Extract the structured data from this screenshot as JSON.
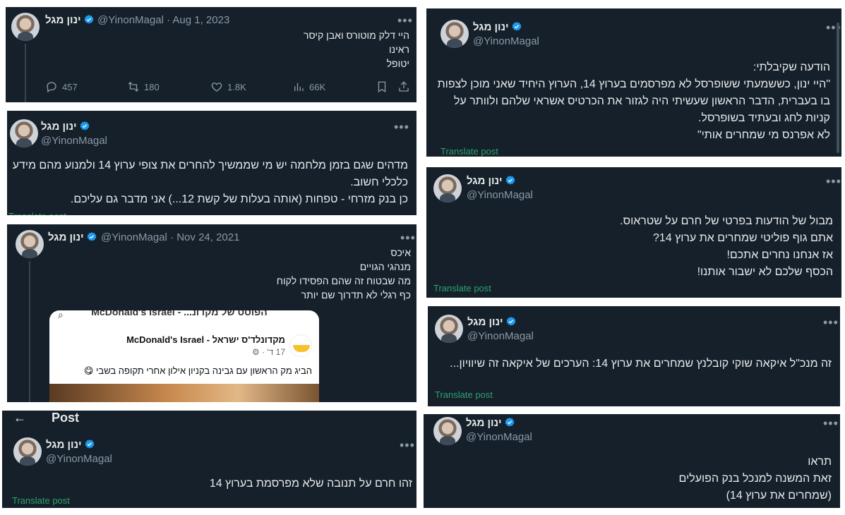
{
  "author": {
    "name": "ינון מגל",
    "handle": "@YinonMagal"
  },
  "more_icon": "•••",
  "translate_label": "Translate post",
  "tweets": {
    "t1": {
      "date": "· Aug 1, 2023",
      "text": "היי דלק מוטורס ואבן קיסר\nראינו\nיטופל",
      "stats": {
        "replies": "457",
        "reposts": "180",
        "likes": "1.8K",
        "views": "66K"
      }
    },
    "t2": {
      "text": "הודעה שקיבלתי:\n\"היי ינון, כששמעתי ששופרסל לא מפרסמים בערוץ 14, הערוץ היחיד שאני מוכן לצפות בו בעברית, הדבר הראשון שעשיתי היה לגזור את הכרטיס אשראי שלהם ולוותר על קניות לחג ובעתיד בשופרסל.\nלא אפרנס מי שמחרים אותי\""
    },
    "t3": {
      "text": "מדהים שגם בזמן מלחמה יש מי שממשיך להחרים את צופי ערוץ 14 ולמנוע מהם מידע כלכלי חשוב.\nכן בנק מזרחי - טפחות (אותה בעלות של קשת 12...) אני מדבר גם עליכם."
    },
    "t4": {
      "text": "מבול של הודעות בפרטי של חרם על שטראוס.\nאתם גוף פוליטי שמחרים את ערוץ 14?\nאז אנחנו נחרים אתכם!\nהכסף שלכם לא ישבור אותנו!"
    },
    "t5": {
      "date": "· Nov 24, 2021",
      "text": "איכס\nמנהגי הגויים\nמה שבטוח זה שהם הפסידו לקוח\nכף רגלי לא תדרוך שם יותר",
      "embed": {
        "header": "הפוסט של מקדונ... - McDonald's Israel",
        "page": "מקדונלד'ס ישראל - McDonald's Israel",
        "meta": "17 ד' · ⚙",
        "body": "הביג מק הראשון עם גבינה בקניון אילון אחרי תקופה בשבי 😋"
      }
    },
    "t6": {
      "text": "זה מנכ\"ל איקאה שוקי קובלנץ שמחרים את ערוץ 14: הערכים של איקאה זה שיוויון..."
    },
    "t7": {
      "back_arrow": "←",
      "title": "Post",
      "text": "זהו חרם על תנובה שלא מפרסמת בערוץ 14"
    },
    "t8": {
      "text": "תראו\nזאת המשנה למנכל בנק הפועלים\n(שמחרים את ערוץ 14)"
    }
  },
  "colors": {
    "card_bg": "#15202b",
    "verified": "#1d9bf0",
    "translate": "#2ea36b"
  }
}
